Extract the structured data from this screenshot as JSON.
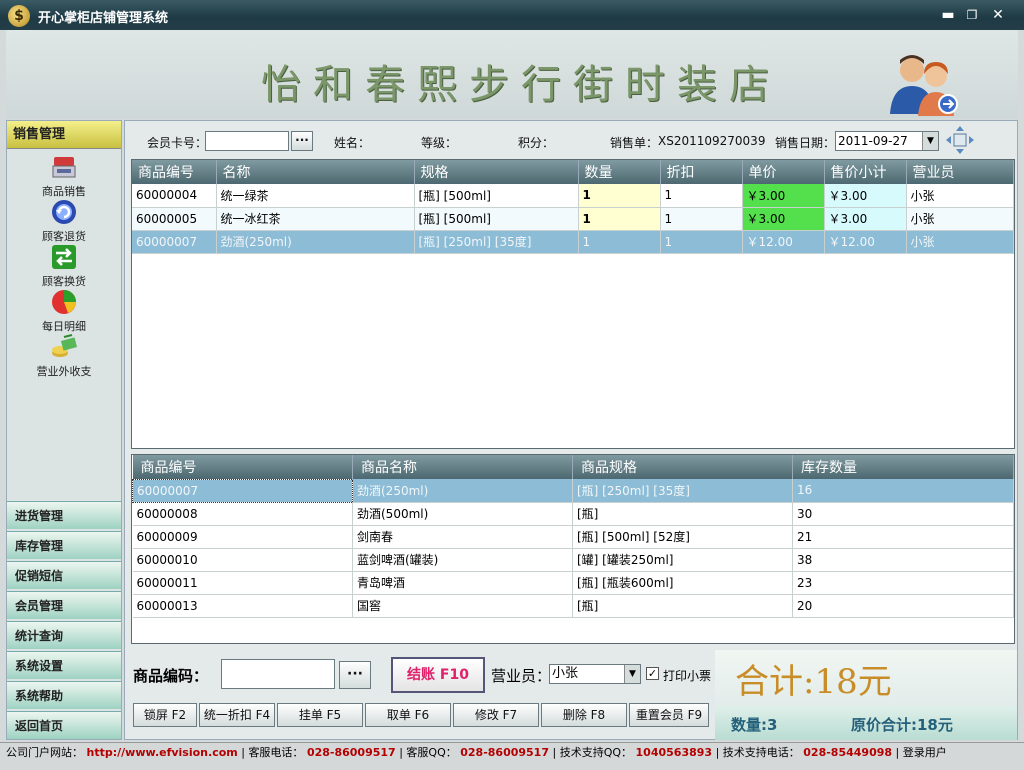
{
  "window": {
    "title": "开心掌柜店铺管理系统",
    "min": "▬",
    "max": "❐",
    "close": "✕"
  },
  "banner": {
    "store_name": "怡和春熙步行街时装店"
  },
  "sidebar": {
    "header": "销售管理",
    "items": [
      {
        "label": "商品销售",
        "icon": "register-icon"
      },
      {
        "label": "顾客退货",
        "icon": "return-icon"
      },
      {
        "label": "顾客换货",
        "icon": "exchange-icon"
      },
      {
        "label": "每日明细",
        "icon": "pie-chart-icon"
      },
      {
        "label": "营业外收支",
        "icon": "money-icon"
      }
    ],
    "nav": [
      "进货管理",
      "库存管理",
      "促销短信",
      "会员管理",
      "统计查询",
      "系统设置",
      "系统帮助",
      "返回首页"
    ]
  },
  "filter": {
    "member_card_label": "会员卡号：",
    "member_card_value": "",
    "browse": "···",
    "name_label": "姓名：",
    "level_label": "等级：",
    "points_label": "积分：",
    "sale_no_label": "销售单：",
    "sale_no": "XS201109270039",
    "sale_date_label": "销售日期：",
    "sale_date": "2011-09-27"
  },
  "sales_table": {
    "columns": [
      "商品编号",
      "名称",
      "规格",
      "数量",
      "折扣",
      "单价",
      "售价小计",
      "营业员"
    ],
    "rows": [
      [
        "60000004",
        "统一绿茶",
        "[瓶] [500ml]",
        "1",
        "1",
        "￥3.00",
        "￥3.00",
        "小张"
      ],
      [
        "60000005",
        "统一冰红茶",
        "[瓶] [500ml]",
        "1",
        "1",
        "￥3.00",
        "￥3.00",
        "小张"
      ],
      [
        "60000007",
        "劲酒(250ml)",
        "[瓶] [250ml] [35度]",
        "1",
        "1",
        "￥12.00",
        "￥12.00",
        "小张"
      ]
    ],
    "selected_row": 2
  },
  "stock_table": {
    "columns": [
      "商品编号",
      "商品名称",
      "商品规格",
      "库存数量"
    ],
    "rows": [
      [
        "60000007",
        "劲酒(250ml)",
        "[瓶] [250ml] [35度]",
        "16"
      ],
      [
        "60000008",
        "劲酒(500ml)",
        "[瓶]",
        "30"
      ],
      [
        "60000009",
        "剑南春",
        "[瓶] [500ml] [52度]",
        "21"
      ],
      [
        "60000010",
        "蓝剑啤酒(罐装)",
        "[罐] [罐装250ml]",
        "38"
      ],
      [
        "60000011",
        "青岛啤酒",
        "[瓶] [瓶装600ml]",
        "23"
      ],
      [
        "60000013",
        "国窖",
        "[瓶]",
        "20"
      ]
    ],
    "selected_row": 0
  },
  "entry": {
    "code_label": "商品编码：",
    "code_value": "",
    "browse": "···",
    "checkout": "结账 F10",
    "clerk_label": "营业员：",
    "clerk_value": "小张",
    "print_receipt": "打印小票",
    "print_checked": true
  },
  "function_keys": [
    "锁屏 F2",
    "统一折扣 F4",
    "挂单 F5",
    "取单 F6",
    "修改 F7",
    "删除 F8",
    "重置会员 F9"
  ],
  "totals": {
    "total": "合计:18元",
    "quantity": "数量:3",
    "original_total": "原价合计:18元"
  },
  "status_bar": {
    "site_label": "公司门户网站：",
    "site": "http://www.efvision.com",
    "phone_label": "客服电话：",
    "phone": "028-86009517",
    "qq_label": "客服QQ：",
    "qq": "028-86009517",
    "tech_qq_label": "技术支持QQ：",
    "tech_qq": "1040563893",
    "tech_phone_label": "技术支持电话：",
    "tech_phone": "028-85449098",
    "user": "登录用户"
  }
}
